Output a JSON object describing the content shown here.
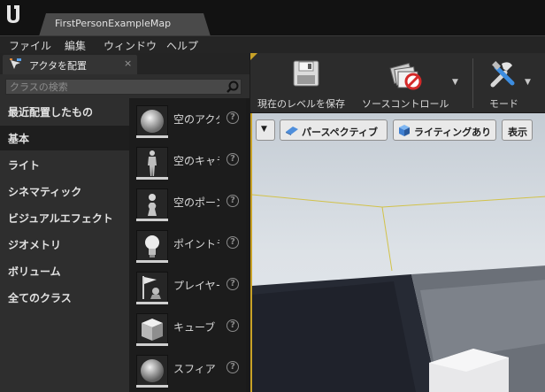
{
  "window": {
    "tab_title": "FirstPersonExampleMap"
  },
  "menu": {
    "items": [
      "ファイル",
      "編集",
      "ウィンドウ",
      "ヘルプ"
    ]
  },
  "place_panel": {
    "tab_label": "アクタを配置",
    "close_glyph": "×",
    "search_placeholder": "クラスの検索",
    "categories": [
      "最近配置したもの",
      "基本",
      "ライト",
      "シネマティック",
      "ビジュアルエフェクト",
      "ジオメトリ",
      "ボリューム",
      "全てのクラス"
    ],
    "selected_category": "基本",
    "items": [
      {
        "label": "空のアクタ",
        "icon": "sphere-actor-icon"
      },
      {
        "label": "空のキャラクター",
        "icon": "character-mannequin-icon"
      },
      {
        "label": "空のポーン",
        "icon": "pawn-icon"
      },
      {
        "label": "ポイントライト",
        "icon": "point-light-bulb-icon"
      },
      {
        "label": "プレイヤースタート",
        "icon": "player-start-flag-icon"
      },
      {
        "label": "キューブ",
        "icon": "cube-icon"
      },
      {
        "label": "スフィア",
        "icon": "sphere-icon"
      }
    ],
    "help_glyph": "?"
  },
  "toolbar": {
    "save_label": "現在のレベルを保存",
    "source_control_label": "ソースコントロール",
    "modes_label": "モード"
  },
  "viewport": {
    "perspective_label": "パースペクティブ",
    "lighting_label": "ライティングあり",
    "show_label": "表示"
  },
  "colors": {
    "accent": "#c9a227",
    "panel_bg": "#2e2e2e",
    "item_bg": "#1c1c1c",
    "toolbar_bg": "#2c2c2c"
  }
}
